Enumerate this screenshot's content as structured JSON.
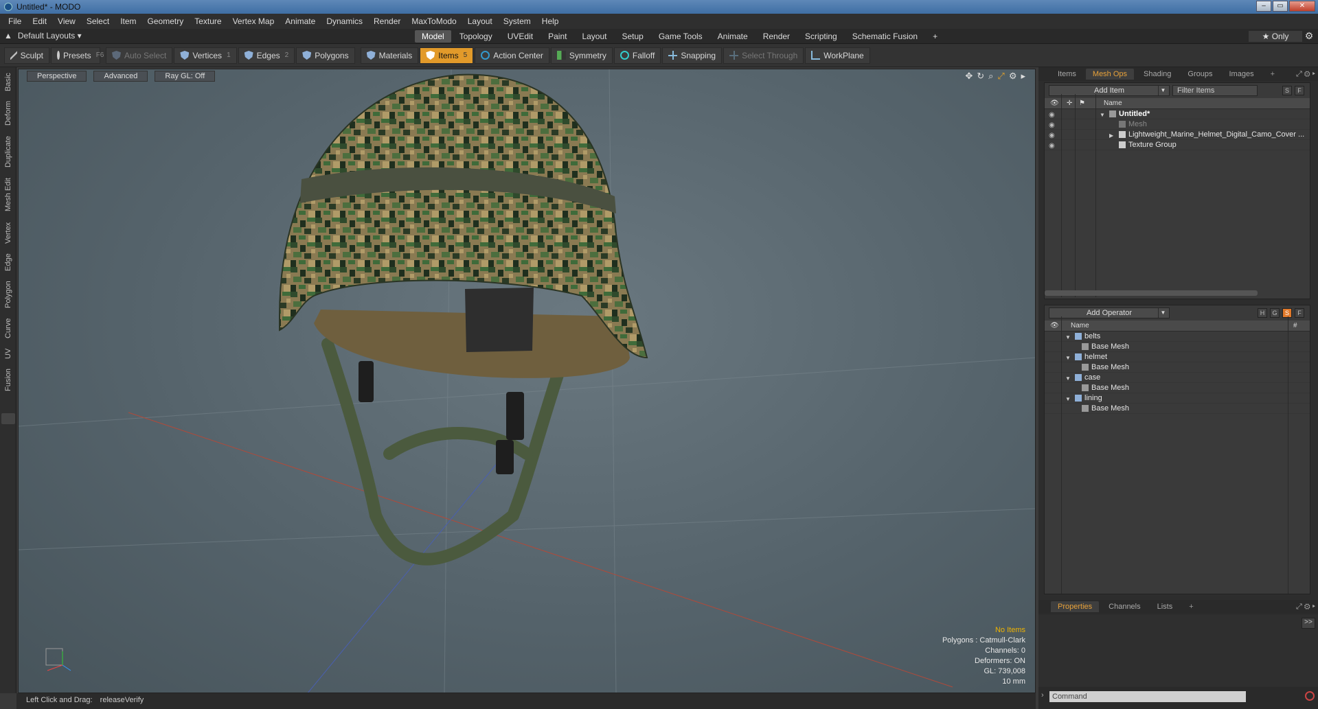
{
  "window": {
    "title": "Untitled* - MODO"
  },
  "menu": [
    "File",
    "Edit",
    "View",
    "Select",
    "Item",
    "Geometry",
    "Texture",
    "Vertex Map",
    "Animate",
    "Dynamics",
    "Render",
    "MaxToModo",
    "Layout",
    "System",
    "Help"
  ],
  "layout": {
    "label": "Default Layouts ▾",
    "tabs": [
      "Model",
      "Topology",
      "UVEdit",
      "Paint",
      "Layout",
      "Setup",
      "Game Tools",
      "Animate",
      "Render",
      "Scripting",
      "Schematic Fusion"
    ],
    "active_tab": "Model",
    "add": "+",
    "only": "★ Only"
  },
  "toolbar": {
    "sculpt": "Sculpt",
    "presets": "Presets",
    "presets_key": "F6",
    "auto_select": "Auto Select",
    "vertices": "Vertices",
    "vertices_key": "1",
    "edges": "Edges",
    "edges_key": "2",
    "polygons": "Polygons",
    "materials": "Materials",
    "items": "Items",
    "items_key": "5",
    "action_center": "Action Center",
    "symmetry": "Symmetry",
    "falloff": "Falloff",
    "snapping": "Snapping",
    "select_through": "Select Through",
    "workplane": "WorkPlane"
  },
  "left_tabs": [
    "Basic",
    "Deform",
    "Duplicate",
    "Mesh Edit",
    "Vertex",
    "Edge",
    "Polygon",
    "Curve",
    "UV",
    "Fusion"
  ],
  "viewport": {
    "perspective": "Perspective",
    "advanced": "Advanced",
    "raygl": "Ray GL: Off",
    "hud": {
      "no_items": "No Items",
      "polygons": "Polygons : Catmull-Clark",
      "channels": "Channels: 0",
      "deformers": "Deformers: ON",
      "gl": "GL: 739,008",
      "scale": "10 mm"
    }
  },
  "status": {
    "label": "Left Click and Drag:",
    "value": "releaseVerify"
  },
  "items_panel": {
    "tabs": [
      "Items",
      "Mesh Ops",
      "Shading",
      "Groups",
      "Images",
      "+"
    ],
    "active": "Mesh Ops",
    "add_item": "Add Item",
    "filter": "Filter Items",
    "s": "S",
    "f": "F",
    "name_col": "Name",
    "rows": [
      {
        "label": "Untitled*"
      },
      {
        "label": "Mesh"
      },
      {
        "label": "Lightweight_Marine_Helmet_Digital_Camo_Cover ..."
      },
      {
        "label": "Texture Group"
      }
    ]
  },
  "ops_panel": {
    "add_operator": "Add Operator",
    "h": "H",
    "g": "G",
    "s": "S",
    "f": "F",
    "name_col": "Name",
    "hash_col": "#",
    "groups": [
      {
        "name": "belts",
        "child": "Base Mesh"
      },
      {
        "name": "helmet",
        "child": "Base Mesh"
      },
      {
        "name": "case",
        "child": "Base Mesh"
      },
      {
        "name": "lining",
        "child": "Base Mesh"
      }
    ]
  },
  "props_panel": {
    "tabs": [
      "Properties",
      "Channels",
      "Lists",
      "+"
    ],
    "active": "Properties",
    "expand": ">>"
  },
  "command": {
    "placeholder": "Command"
  },
  "colors": {
    "accent": "#e29a2a",
    "tab_active_text": "#e8a23a",
    "hud_warning": "#f0b400"
  }
}
